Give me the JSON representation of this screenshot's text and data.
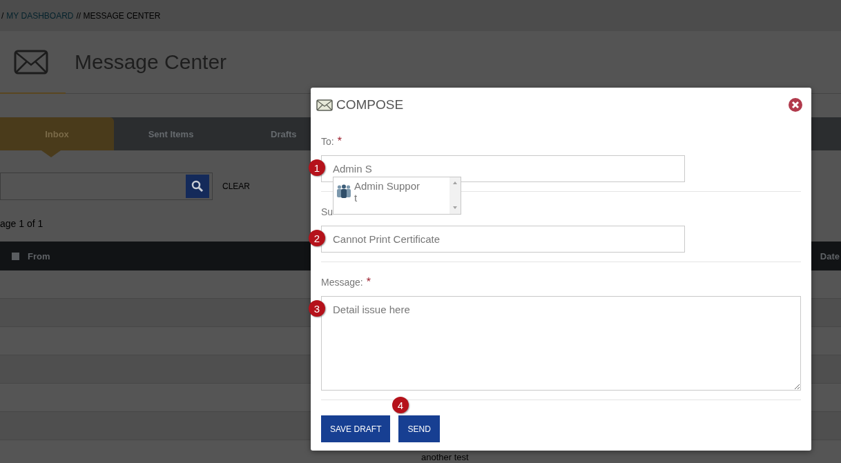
{
  "breadcrumb": [
    {
      "text": "/",
      "kind": "plain"
    },
    {
      "text": "MY DASHBOARD",
      "kind": "link"
    },
    {
      "text": "// MESSAGE CENTER",
      "kind": "plain"
    }
  ],
  "page_title": "Message Center",
  "tabs": [
    {
      "label": "Inbox",
      "selected": true
    },
    {
      "label": "Sent Items",
      "selected": false
    },
    {
      "label": "Drafts",
      "selected": false
    }
  ],
  "search": {
    "clear": "CLEAR"
  },
  "pagination": "age 1 of 1",
  "table": {
    "columns": [
      {
        "label": "From",
        "checked": false
      },
      {
        "label": "Date"
      }
    ],
    "rows": [
      {
        "kind": "blank"
      },
      {
        "kind": "blank"
      },
      {
        "kind": "blank"
      },
      {
        "kind": "blank"
      },
      {
        "kind": "blank"
      },
      {
        "kind": "blank"
      },
      {
        "kind": "text",
        "column_2": "another test"
      }
    ]
  },
  "compose": {
    "title": "COMPOSE",
    "fields": [
      {
        "kind": "input",
        "label": "To:",
        "required_mark": "*",
        "value": "Admin S",
        "badge": "1"
      },
      {
        "kind": "input",
        "label": "Su",
        "value": "Cannot Print Certificate",
        "badge": "2"
      },
      {
        "kind": "textarea",
        "label": "Message:",
        "required_mark": "*",
        "value": "Detail issue here",
        "badge": "3"
      }
    ],
    "suggestions": [
      {
        "label": "Admin Support"
      }
    ],
    "buttons": [
      {
        "label": "SAVE DRAFT"
      },
      {
        "label": "SEND"
      }
    ],
    "buttons_badge": "4"
  }
}
